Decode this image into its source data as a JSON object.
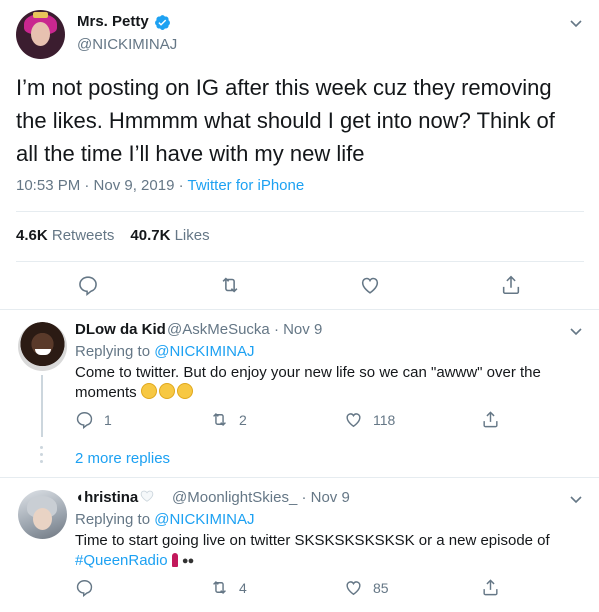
{
  "main_tweet": {
    "display_name": "Mrs. Petty",
    "handle": "@NICKIMINAJ",
    "text": "I’m not posting on IG after this week cuz they removing the likes. Hmmmm what should I get into now? Think of all the time I’ll have with my new life",
    "timestamp": "10:53 PM · Nov 9, 2019 · ",
    "source": "Twitter for iPhone",
    "retweet_count": "4.6K",
    "retweet_label": "Retweets",
    "like_count": "40.7K",
    "like_label": "Likes",
    "icons": [
      "reply-icon",
      "retweet-icon",
      "like-icon",
      "share-icon"
    ]
  },
  "replies": [
    {
      "display_name": "DLow da Kid",
      "handle": "@AskMeSucka",
      "date": "· Nov 9",
      "replying_prefix": "Replying to ",
      "replying_to": "@NICKIMINAJ",
      "text": "Come to twitter. But do enjoy your new life so we can \"awww\" over the moments",
      "emojis": [
        "weary-face",
        "weary-face",
        "grinning-face"
      ],
      "reply_count": "1",
      "retweet_count": "2",
      "like_count": "118",
      "more_replies": "2 more replies"
    },
    {
      "display_name": "Christina",
      "display_name_prefix": "◖",
      "display_name_body": "hristina",
      "handle": "@MoonlightSkies_",
      "date": "· Nov 9",
      "replying_prefix": "Replying to ",
      "replying_to": "@NICKIMINAJ",
      "text": "Time to start going live on twitter SKSKSKSKSKSK or a new episode of ",
      "hashtag": "#QueenRadio",
      "retweet_count": "4",
      "like_count": "85"
    }
  ],
  "colors": {
    "accent": "#1da1f2",
    "secondary_text": "#657786",
    "primary_text": "#14171a",
    "border": "#e6ecf0"
  }
}
